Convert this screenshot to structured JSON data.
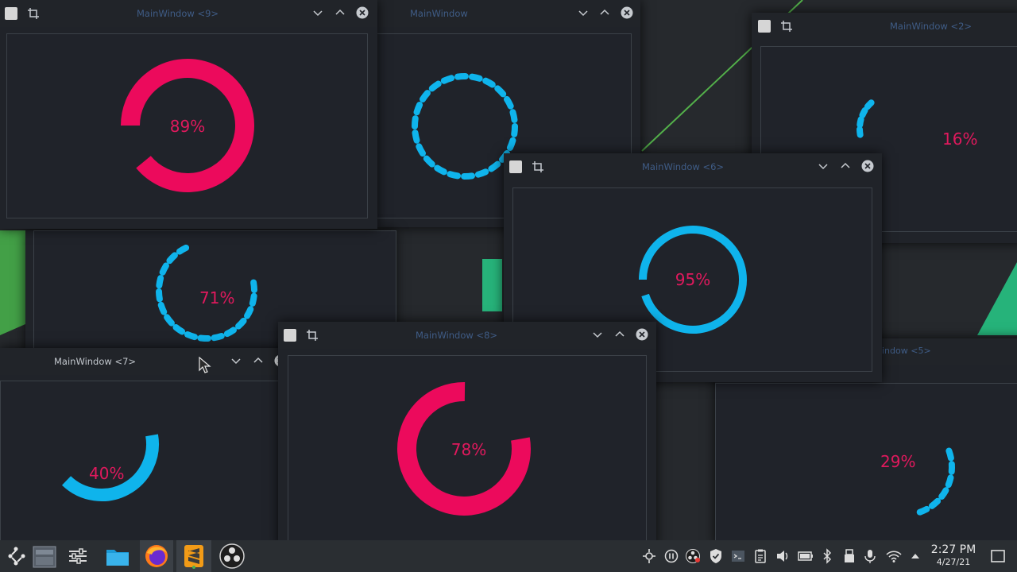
{
  "windows": [
    {
      "id": "win2",
      "title": "MainWindow <2>",
      "percent_label": "16%",
      "progress": 0.16,
      "color": "#0fb4ec",
      "style": "dashed"
    },
    {
      "id": "win1",
      "title": "MainWindow",
      "percent_label": "",
      "progress": 1.0,
      "color": "#0fb4ec",
      "style": "dashed"
    },
    {
      "id": "win3",
      "title": "",
      "percent_label": "71%",
      "progress": 0.71,
      "color": "#0fb4ec",
      "style": "dashed"
    },
    {
      "id": "win9",
      "title": "MainWindow <9>",
      "percent_label": "89%",
      "progress": 0.89,
      "color": "#ec0a5c",
      "style": "solid"
    },
    {
      "id": "win5",
      "title": "indow <5>",
      "percent_label": "29%",
      "progress": 0.29,
      "color": "#0fb4ec",
      "style": "dashed"
    },
    {
      "id": "win6",
      "title": "MainWindow <6>",
      "percent_label": "95%",
      "progress": 0.95,
      "color": "#0fb4ec",
      "style": "solid"
    },
    {
      "id": "win7",
      "title": "MainWindow <7>",
      "percent_label": "40%",
      "progress": 0.4,
      "color": "#0fb4ec",
      "style": "solid"
    },
    {
      "id": "win8",
      "title": "MainWindow <8>",
      "percent_label": "78%",
      "progress": 0.78,
      "color": "#ec0a5c",
      "style": "solid"
    }
  ],
  "percent_text_color": "#e0195d",
  "taskbar": {
    "apps": [
      "app-launcher-icon",
      "pager-icon",
      "task-manager-icon",
      "file-manager-icon",
      "firefox-icon",
      "sublime-text-icon",
      "obs-studio-icon"
    ],
    "tray": [
      "vpn-icon",
      "media-pause-icon",
      "obs-tray-icon",
      "security-icon",
      "terminal-icon",
      "clipboard-icon",
      "volume-icon",
      "battery-icon",
      "bluetooth-icon",
      "device-icon",
      "microphone-icon",
      "wifi-icon",
      "tray-expand-icon"
    ],
    "clock": {
      "time": "2:27 PM",
      "date": "4/27/21"
    }
  }
}
